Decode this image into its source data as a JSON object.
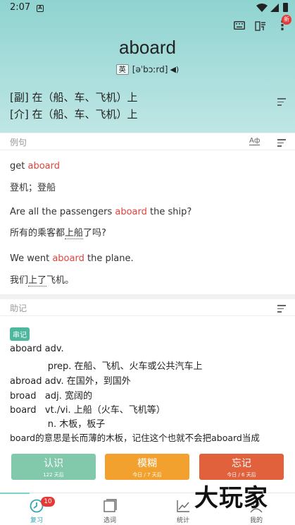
{
  "status_bar": {
    "time": "2:07",
    "notification_icon": "A"
  },
  "header": {
    "word": "aboard",
    "accent_tag": "英",
    "phonetic": "[əˈbɔːrd]",
    "new_badge": "新",
    "icons": [
      "keyboard-icon",
      "dictionary-icon",
      "more-icon"
    ]
  },
  "definitions": [
    "[副] 在（船、车、飞机）上",
    "[介] 在（船、车、飞机）上"
  ],
  "examples": {
    "title": "例句",
    "items": [
      {
        "pre": "get ",
        "hl": "aboard",
        "post": "",
        "zh_pre": "登机；登船",
        "zh_dot": "",
        "zh_post": ""
      },
      {
        "pre": "Are all the passengers ",
        "hl": "aboard",
        "post": " the ship?",
        "zh_pre": "所有的乘客都",
        "zh_dot": "上船",
        "zh_post": "了吗?"
      },
      {
        "pre": "We went ",
        "hl": "aboard",
        "post": " the plane.",
        "zh_pre": "我们",
        "zh_dot": "上了",
        "zh_post": "飞机。"
      }
    ]
  },
  "mnemonic": {
    "title": "助记",
    "tag": "串记",
    "lines": [
      "aboard adv.",
      "             prep. 在船、飞机、火车或公共汽车上",
      "abroad adv. 在国外，到国外",
      "broad   adj. 宽阔的",
      "board   vt./vi. 上船（火车、飞机等）",
      "             n. 木板，板子",
      "board的意思是长而薄的木板，记住这个也就不会把aboard当成"
    ]
  },
  "actions": {
    "know": {
      "label": "认识",
      "sub": "122 天后",
      "color": "#82c9ac"
    },
    "vague": {
      "label": "模糊",
      "sub": "今日 / 7 天后",
      "color": "#f2a12e"
    },
    "forget": {
      "label": "忘记",
      "sub": "今日 / 6 天后",
      "color": "#e2613d"
    }
  },
  "tabs": [
    {
      "label": "复习",
      "badge": "10"
    },
    {
      "label": "选词"
    },
    {
      "label": "统计"
    },
    {
      "label": "我的"
    }
  ],
  "watermark": "大玩家",
  "colors": {
    "accent": "#2fa7b6",
    "highlight": "#e0443b",
    "header_bg": "#a9dedc"
  }
}
